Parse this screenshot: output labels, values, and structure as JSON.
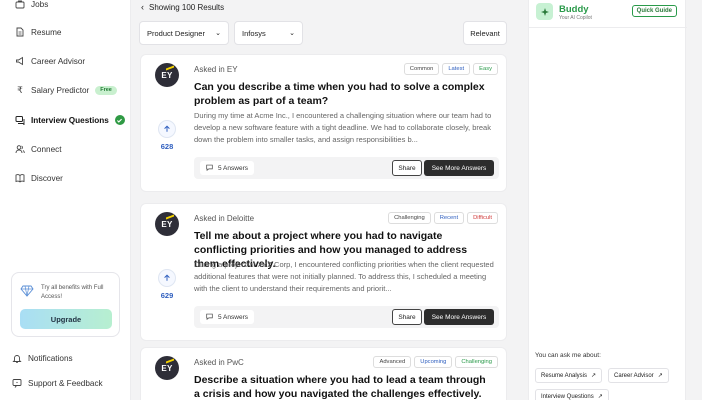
{
  "sidebar": {
    "items": [
      {
        "label": "Jobs",
        "icon": "briefcase-icon"
      },
      {
        "label": "Resume",
        "icon": "document-icon"
      },
      {
        "label": "Career Advisor",
        "icon": "megaphone-icon"
      },
      {
        "label": "Salary Predictor",
        "icon": "rupee-icon",
        "badge": "Free"
      },
      {
        "label": "Interview Questions",
        "icon": "chat-icon",
        "active": true
      },
      {
        "label": "Connect",
        "icon": "people-icon"
      },
      {
        "label": "Discover",
        "icon": "book-icon"
      }
    ],
    "promo": {
      "text": "Try all benefits with Full Access!",
      "button": "Upgrade"
    },
    "bottom": [
      {
        "label": "Notifications",
        "icon": "bell-icon"
      },
      {
        "label": "Support & Feedback",
        "icon": "support-icon"
      }
    ]
  },
  "main": {
    "results_text": "Showing 100 Results",
    "filters": {
      "role": "Product Designer",
      "company": "Infosys",
      "sort": "Relevant"
    },
    "cards": [
      {
        "asked_in": "Asked in EY",
        "tags": [
          {
            "label": "Common",
            "color": "#444444"
          },
          {
            "label": "Latest",
            "color": "#2f5fbf"
          },
          {
            "label": "Easy",
            "color": "#2a9a4a"
          }
        ],
        "question": "Can you describe a time when you had to solve a complex problem as part of a team?",
        "answer": "During my time at Acme Inc., I encountered a challenging situation where our team had to develop a new software feature with a tight deadline. We had to collaborate closely, break down the problem into smaller tasks, and assign responsibilities b...",
        "votes": "628",
        "answers_count": "5 Answers",
        "share": "Share",
        "more": "See More Answers"
      },
      {
        "asked_in": "Asked in Deloitte",
        "tags": [
          {
            "label": "Challenging",
            "color": "#444444"
          },
          {
            "label": "Recent",
            "color": "#2f5fbf"
          },
          {
            "label": "Difficult",
            "color": "#d03a3a"
          }
        ],
        "question": "Tell me about a project where you had to navigate conflicting priorities and how you managed to address them effectively.",
        "answer": "During a project at XYZ Corp, I encountered conflicting priorities when the client requested additional features that were not initially planned. To address this, I scheduled a meeting with the client to understand their requirements and priorit...",
        "votes": "629",
        "answers_count": "5 Answers",
        "share": "Share",
        "more": "See More Answers"
      },
      {
        "asked_in": "Asked in PwC",
        "tags": [
          {
            "label": "Advanced",
            "color": "#444444"
          },
          {
            "label": "Upcoming",
            "color": "#2f5fbf"
          },
          {
            "label": "Challenging",
            "color": "#2a9a4a"
          }
        ],
        "question": "Describe a situation where you had to lead a team through a crisis and how you navigated the challenges effectively."
      }
    ]
  },
  "right": {
    "name": "Buddy",
    "subtitle": "Your AI Copilot",
    "quick_guide": "Quick Guide",
    "ask_me": "You can ask me about:",
    "chips": [
      "Resume Analysis",
      "Career Advisor",
      "Interview Questions"
    ]
  }
}
